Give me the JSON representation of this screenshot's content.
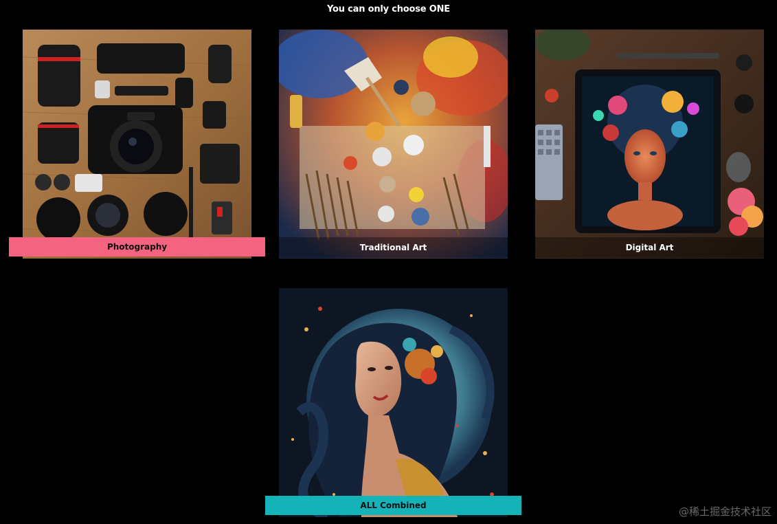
{
  "heading": "You can only choose ONE",
  "options": [
    {
      "label": "Photography",
      "state": "selected",
      "accent": "#f4637f"
    },
    {
      "label": "Traditional Art",
      "state": "normal"
    },
    {
      "label": "Digital Art",
      "state": "normal"
    },
    {
      "label": "ALL Combined",
      "state": "highlighted",
      "accent": "#13b3b8"
    }
  ],
  "watermark": "@稀土掘金技术社区",
  "colors": {
    "background": "#000000",
    "selected": "#f4637f",
    "highlight": "#13b3b8"
  }
}
